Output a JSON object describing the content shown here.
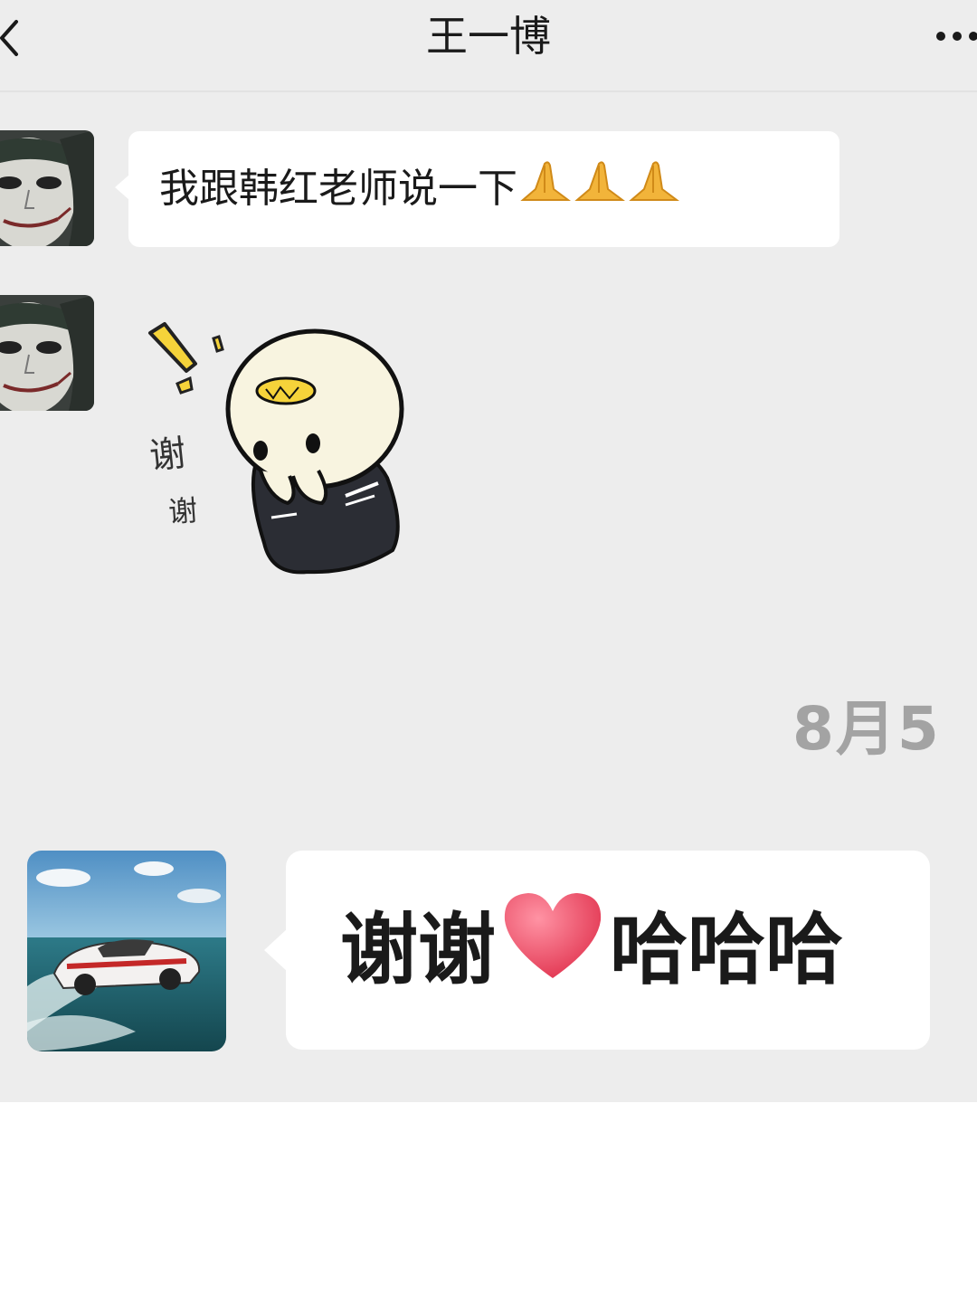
{
  "header": {
    "back_icon": "chevron-left-icon",
    "title": "王一博",
    "more_icon": "ellipsis-icon"
  },
  "messages": [
    {
      "sender": "contact",
      "avatar_icon": "joker-avatar",
      "text": "我跟韩红老师说一下",
      "emoji_icon": "folded-hands-icon",
      "emoji_count": 3
    },
    {
      "sender": "contact",
      "avatar_icon": "joker-avatar",
      "sticker": {
        "icon": "thank-you-sticker",
        "text_1": "谢",
        "text_2": "谢"
      }
    },
    {
      "sender": "contact",
      "avatar_icon": "car-avatar",
      "text_before": "谢谢",
      "emoji_icon": "heart-icon",
      "text_after": "哈哈哈"
    }
  ],
  "timestamp": "8月5",
  "colors": {
    "chat_background": "#ededed",
    "bubble": "#ffffff",
    "timestamp": "#a3a3a3",
    "heart": "#e8475e",
    "emoji_gold": "#f2b43a"
  }
}
